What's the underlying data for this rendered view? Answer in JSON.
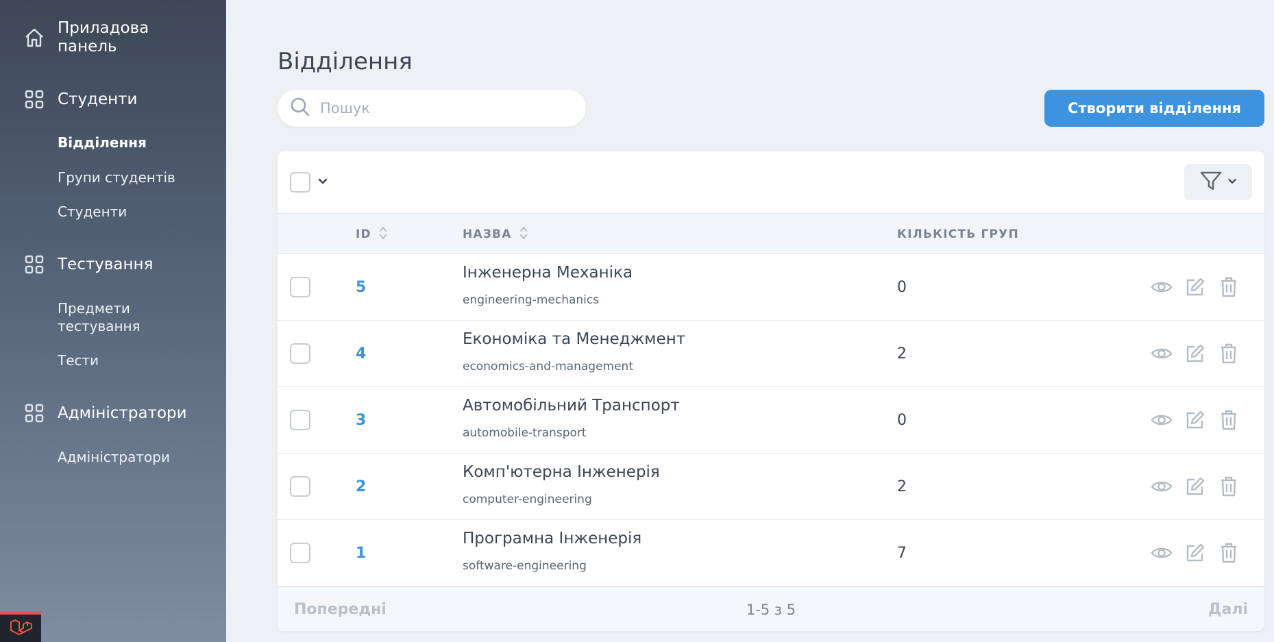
{
  "sidebar": {
    "dashboard": {
      "label": "Приладова панель",
      "icon": "home-icon"
    },
    "students_section": {
      "label": "Студенти",
      "icon": "grid-icon"
    },
    "students_items": [
      {
        "label": "Відділення",
        "active": true
      },
      {
        "label": "Групи студентів",
        "active": false
      },
      {
        "label": "Студенти",
        "active": false
      }
    ],
    "testing_section": {
      "label": "Тестування",
      "icon": "grid-icon"
    },
    "testing_items": [
      {
        "label": "Предмети тестування"
      },
      {
        "label": "Тести"
      }
    ],
    "admins_section": {
      "label": "Адміністратори",
      "icon": "grid-icon"
    },
    "admins_items": [
      {
        "label": "Адміністратори"
      }
    ]
  },
  "page": {
    "title": "Відділення",
    "search_placeholder": "Пошук",
    "search_value": "",
    "create_button": "Створити відділення"
  },
  "table": {
    "columns": {
      "id": "ID",
      "name": "НАЗВА",
      "groups_count": "КІЛЬКІСТЬ ГРУП"
    },
    "rows": [
      {
        "id": "5",
        "name": "Інженерна Механіка",
        "slug": "engineering-mechanics",
        "groups_count": "0"
      },
      {
        "id": "4",
        "name": "Економіка та Менеджмент",
        "slug": "economics-and-management",
        "groups_count": "2"
      },
      {
        "id": "3",
        "name": "Автомобільний Транспорт",
        "slug": "automobile-transport",
        "groups_count": "0"
      },
      {
        "id": "2",
        "name": "Комп'ютерна Інженерія",
        "slug": "computer-engineering",
        "groups_count": "2"
      },
      {
        "id": "1",
        "name": "Програмна Інженерія",
        "slug": "software-engineering",
        "groups_count": "7"
      }
    ]
  },
  "pagination": {
    "prev": "Попередні",
    "info": "1-5 з 5",
    "next": "Далі"
  },
  "colors": {
    "accent": "#3d93dd",
    "sidebar_top": "#3d4756",
    "sidebar_bottom": "#7e8da0",
    "background": "#eef1f4"
  }
}
